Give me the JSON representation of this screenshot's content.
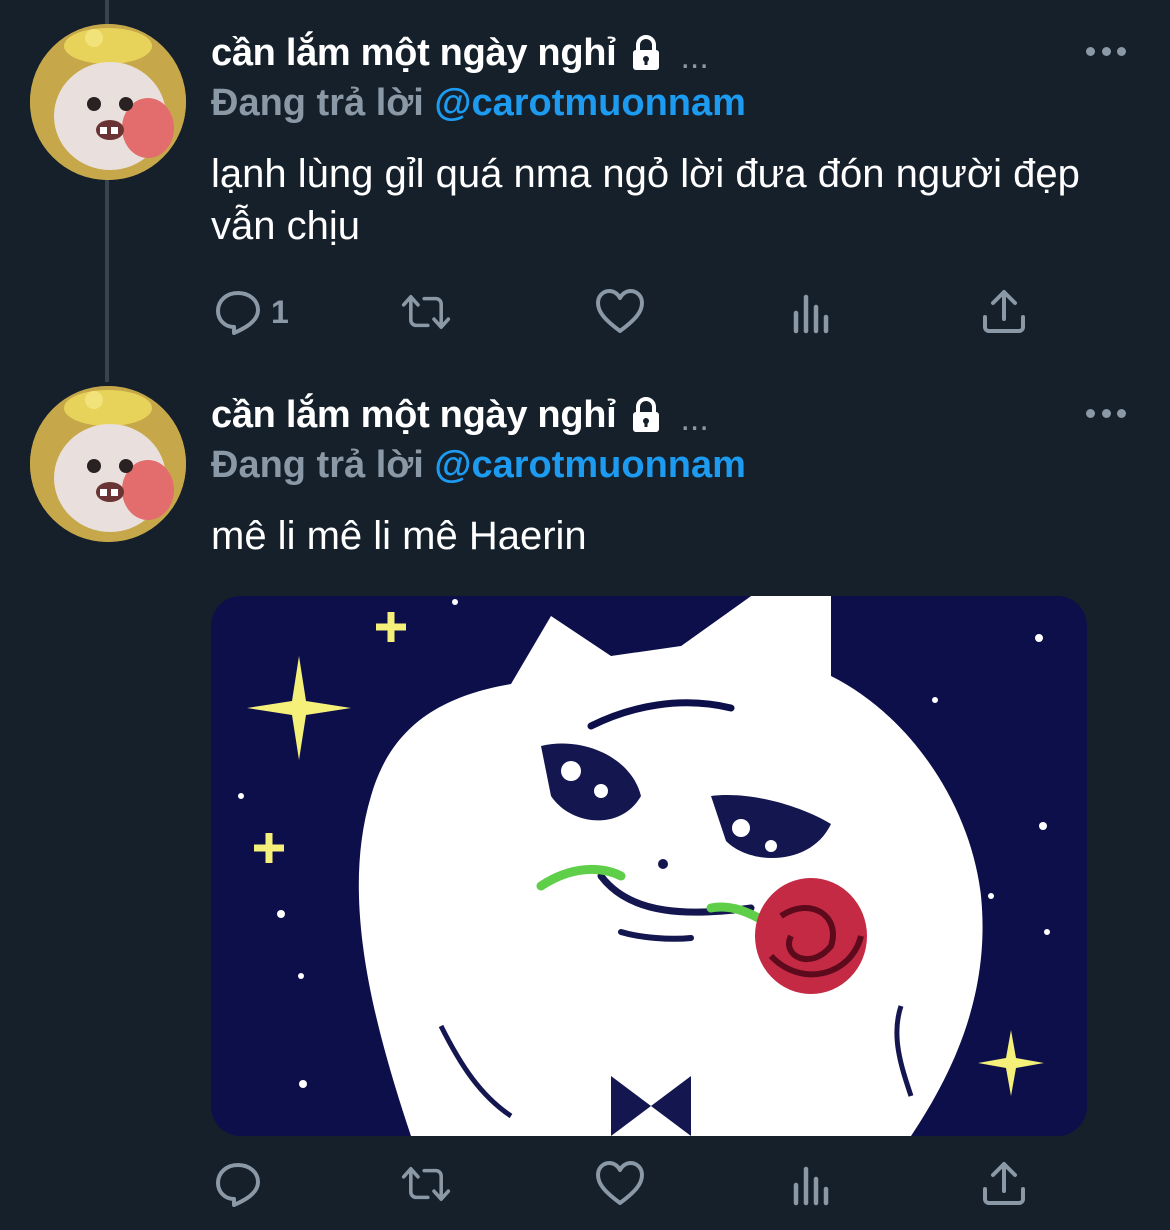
{
  "app": {
    "theme_colors": {
      "background": "#15202b",
      "accent": "#1d9bf0",
      "muted": "#8b98a5",
      "text": "#ffffff"
    }
  },
  "tweets": [
    {
      "display_name": "cần lắm một ngày nghỉ",
      "protected_icon": "lock-icon",
      "more_inline": "...",
      "reply_label": "Đang trả lời",
      "reply_handle": "@carotmuonnam",
      "text": "lạnh lùng gỉl quá nma ngỏ lời đưa đón người đẹp vẫn chịu",
      "actions": {
        "reply_count": "1",
        "retweet_count": "",
        "like_count": ""
      }
    },
    {
      "display_name": "cần lắm một ngày nghỉ",
      "protected_icon": "lock-icon",
      "more_inline": "...",
      "reply_label": "Đang trả lời",
      "reply_handle": "@carotmuonnam",
      "text": "mê li mê li mê Haerin",
      "media": {
        "description_icon": "cartoon-cat-rose-image"
      },
      "actions": {
        "reply_count": "",
        "retweet_count": "",
        "like_count": ""
      }
    }
  ]
}
